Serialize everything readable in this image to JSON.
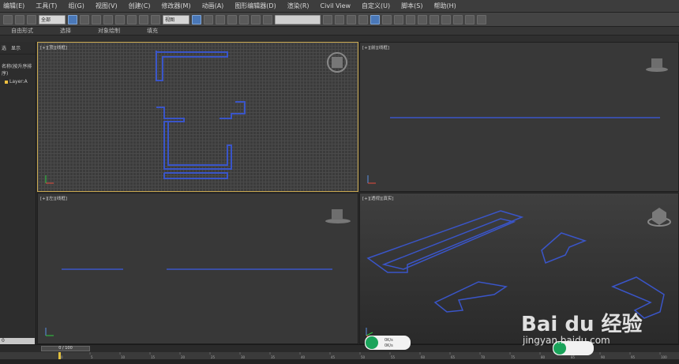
{
  "menu": [
    "编辑(E)",
    "工具(T)",
    "组(G)",
    "视图(V)",
    "创建(C)",
    "修改器(M)",
    "动画(A)",
    "图形编辑器(D)",
    "渲染(R)",
    "Civil View",
    "自定义(U)",
    "脚本(S)",
    "帮助(H)"
  ],
  "toolbar": {
    "filter_value": "全部",
    "view_value": "视图"
  },
  "ribbon": [
    "自由形式",
    "选择",
    "对象绘制",
    "填充"
  ],
  "scene": {
    "tab_select": "选",
    "tab_display": "显示",
    "header": "名称(按升序排序)",
    "layer": "Layer:A",
    "bottom_value": "0"
  },
  "viewports": {
    "top": {
      "label": "[+][顶][线框]"
    },
    "front": {
      "label": "[+][前][线框]"
    },
    "left": {
      "label": "[+][左][线框]"
    },
    "persp": {
      "label": "[+][透视][真实]"
    }
  },
  "timeline": {
    "slider": "0 / 100",
    "ticks": [
      "0",
      "5",
      "10",
      "15",
      "20",
      "25",
      "30",
      "35",
      "40",
      "45",
      "50",
      "55",
      "60",
      "65",
      "70",
      "75",
      "80",
      "85",
      "90",
      "95",
      "100"
    ]
  },
  "overlay": {
    "upload": "0K/s",
    "download": "0K/s"
  },
  "watermark": {
    "logo": "Bai du 经验",
    "url": "jingyan.baidu.com"
  },
  "colors": {
    "linework": "#3a55c8",
    "active_border": "#c8a850",
    "badge_green": "#1aa35a"
  }
}
